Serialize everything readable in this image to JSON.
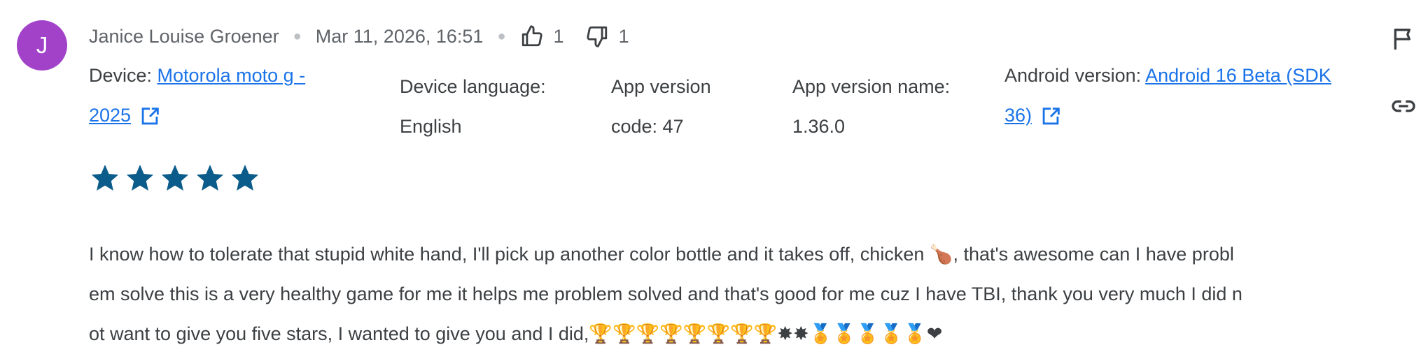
{
  "author": {
    "initial": "J",
    "name": "Janice Louise Groener",
    "date": "Mar 11, 2026, 16:51"
  },
  "votes": {
    "up": "1",
    "down": "1"
  },
  "device": {
    "label": "Device:",
    "line1": "Motorola moto g -",
    "line2": "2025"
  },
  "language": {
    "label": "Device language:",
    "value": "English"
  },
  "app_version_code": {
    "line1": "App version",
    "line2": "code: 47"
  },
  "app_version_name": {
    "line1": "App version name:",
    "line2": "1.36.0"
  },
  "android": {
    "label": "Android version:",
    "line1": "Android 16 Beta (SDK",
    "line2": "36)"
  },
  "rating": {
    "stars": 5,
    "max": 5
  },
  "review": {
    "line1": "I know how to tolerate that stupid white hand, I'll pick up another color bottle and it takes off, chicken 🍗, that's awesome can I have probl",
    "line2": "em solve this is a very healthy game for me it helps me problem solved and that's good for me cuz I have TBI, thank you very much I did n",
    "line3": "ot want to give you five stars, I wanted to give you and I did,🏆🏆🏆🏆🏆🏆🏆🏆✸✸🏅🏅🏅🏅🏅❤"
  },
  "icons": {
    "flag": "flag-icon",
    "link": "link-icon",
    "thumbs_up": "thumbs-up-icon",
    "thumbs_down": "thumbs-down-icon",
    "open_in_new": "open-in-new-icon",
    "star": "star-icon"
  },
  "colors": {
    "avatar": "#a142c9",
    "link": "#1a73e8",
    "star": "#0b5c8a",
    "text": "#3c4043",
    "muted": "#5f6368"
  }
}
